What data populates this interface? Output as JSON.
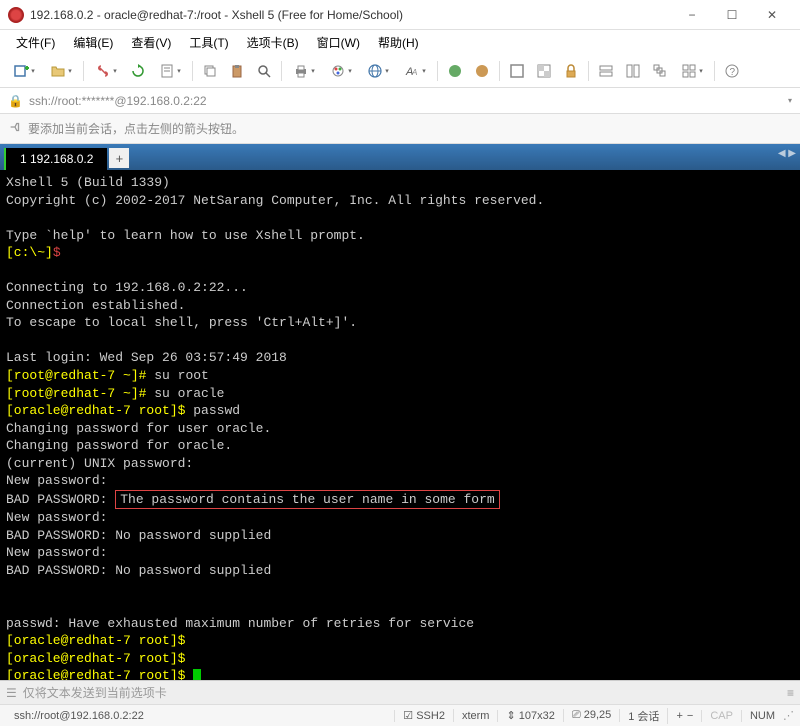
{
  "window": {
    "title": "192.168.0.2 - oracle@redhat-7:/root - Xshell 5 (Free for Home/School)"
  },
  "menu": {
    "file": "文件(F)",
    "edit": "编辑(E)",
    "view": "查看(V)",
    "tools": "工具(T)",
    "tabs": "选项卡(B)",
    "window": "窗口(W)",
    "help": "帮助(H)"
  },
  "address": {
    "url": "ssh://root:*******@192.168.0.2:22"
  },
  "info": {
    "hint": "要添加当前会话，点击左侧的箭头按钮。"
  },
  "tabs": {
    "active": "1 192.168.0.2",
    "add": "+"
  },
  "terminal": {
    "header1": "Xshell 5 (Build 1339)",
    "header2": "Copyright (c) 2002-2017 NetSarang Computer, Inc. All rights reserved.",
    "help": "Type `help' to learn how to use Xshell prompt.",
    "prompt1_a": "[c:\\~]",
    "prompt1_b": "$",
    "conn1": "Connecting to 192.168.0.2:22...",
    "conn2": "Connection established.",
    "conn3": "To escape to local shell, press 'Ctrl+Alt+]'.",
    "login": "Last login: Wed Sep 26 03:57:49 2018",
    "p_root1_a": "[root@redhat-7 ~]#",
    "p_root1_b": " su root",
    "p_root2_a": "[root@redhat-7 ~]#",
    "p_root2_b": " su oracle",
    "p_oracle1_a": "[oracle@redhat-7 root]$",
    "p_oracle1_b": " passwd",
    "chg1": "Changing password for user oracle.",
    "chg2": "Changing password for oracle.",
    "cur": "(current) UNIX password:",
    "np1": "New password:",
    "bad_label1": "BAD PASSWORD: ",
    "bad1": "The password contains the user name in some form",
    "np2": "New password:",
    "bad2": "BAD PASSWORD: No password supplied",
    "np3": "New password:",
    "bad3": "BAD PASSWORD: No password supplied",
    "exhaust": "passwd: Have exhausted maximum number of retries for service",
    "p_end1": "[oracle@redhat-7 root]$",
    "p_end2": "[oracle@redhat-7 root]$",
    "p_end3": "[oracle@redhat-7 root]$"
  },
  "footer": {
    "hint": "仅将文本发送到当前选项卡"
  },
  "status": {
    "conn": "ssh://root@192.168.0.2:22",
    "proto": "SSH2",
    "term": "xterm",
    "size": "107x32",
    "pos": "29,25",
    "sessions": "1 会话",
    "cap": "CAP",
    "num": "NUM"
  },
  "icons": {
    "size_arrow": "⇕",
    "pos_arrow": "→",
    "plus": "+",
    "minus": "−",
    "times": "✕",
    "square": "☐"
  }
}
